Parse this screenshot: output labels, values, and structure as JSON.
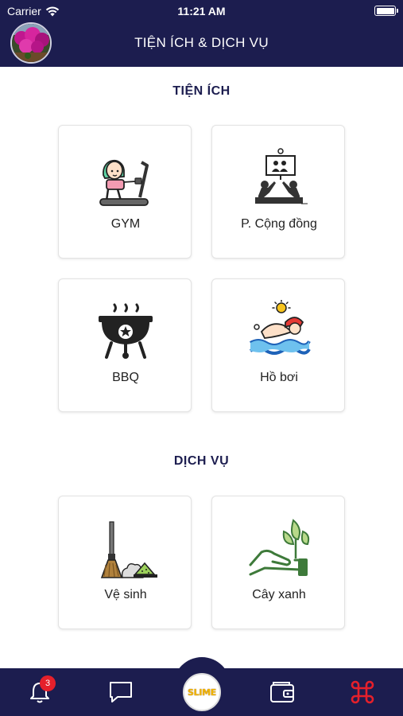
{
  "status_bar": {
    "carrier": "Carrier",
    "time": "11:21 AM",
    "battery_level": 1.0
  },
  "header": {
    "title": "TIỆN ÍCH & DỊCH VỤ"
  },
  "sections": {
    "utilities": {
      "title": "TIỆN ÍCH",
      "items": [
        {
          "label": "GYM",
          "icon": "treadmill-icon"
        },
        {
          "label": "P. Cộng đồng",
          "icon": "community-room-icon"
        },
        {
          "label": "BBQ",
          "icon": "bbq-grill-icon"
        },
        {
          "label": "Hồ bơi",
          "icon": "swimming-icon"
        }
      ]
    },
    "services": {
      "title": "DỊCH VỤ",
      "items": [
        {
          "label": "Vệ sinh",
          "icon": "broom-cleaning-icon"
        },
        {
          "label": "Cây xanh",
          "icon": "plant-in-hand-icon"
        }
      ]
    }
  },
  "tab_bar": {
    "notification_count": "3",
    "center_label": "SLIME",
    "accent_color": "#e5202b",
    "background_color": "#1c1d4f"
  }
}
